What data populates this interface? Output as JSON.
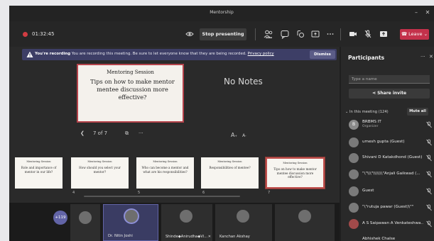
{
  "window": {
    "title": "Mentorship"
  },
  "toolbar": {
    "timer": "01:32:45",
    "stop_presenting": "Stop presenting",
    "leave": "Leave"
  },
  "banner": {
    "lead": "You're recording",
    "message": "You are recording this meeting. Be sure to let everyone know that they are being recorded.",
    "link": "Privacy policy",
    "dismiss": "Dismiss"
  },
  "slide": {
    "heading": "Mentoring Session",
    "body": "Tips on how to make mentor mentee discussion more effective?"
  },
  "notes": {
    "empty": "No Notes"
  },
  "slide_nav": {
    "position": "7 of 7",
    "more": "···"
  },
  "font_controls": {
    "larger": "A",
    "smaller": "A"
  },
  "thumbnails": [
    {
      "heading": "Mentoring Session",
      "body": "Role and importance of mentor in our life?",
      "num": ""
    },
    {
      "heading": "Mentoring Session",
      "body": "How should you select your mentor?",
      "num": "4"
    },
    {
      "heading": "Mentoring Session",
      "body": "Who can become a mentor and what are his responsibilities?",
      "num": "5"
    },
    {
      "heading": "Mentoring Session",
      "body": "Responsibilities of mentee?",
      "num": "6"
    },
    {
      "heading": "Mentoring Session",
      "body": "Tips on how to make mentor mentee discussion more effective?",
      "num": "7"
    }
  ],
  "video_strip": {
    "more_count": "+119",
    "tiles": [
      {
        "name": ""
      },
      {
        "name": "Dr. Nitin Joshi"
      },
      {
        "name": "Shinde◆Anirudha◆Vi..."
      },
      {
        "name": "Kanchan Akshay"
      },
      {
        "name": ""
      }
    ]
  },
  "participants": {
    "title": "Participants",
    "search_placeholder": "Type a name",
    "share_invite": "Share invite",
    "section": "In this meeting (124)",
    "mute_all": "Mute all",
    "list": [
      {
        "name": "BRBMS IT",
        "sub": "Organizer",
        "initials": "B"
      },
      {
        "name": "umesh gupta (Guest)",
        "sub": "",
        "initials": ""
      },
      {
        "name": "Shivani D Katakdhond (Guest)",
        "sub": "",
        "initials": ""
      },
      {
        "name": "\"\\\"\\\\\\\"\\\\\\\\\\\\\\\"Anjali Gaikwad (...",
        "sub": "",
        "initials": ""
      },
      {
        "name": "Guest",
        "sub": "",
        "initials": ""
      },
      {
        "name": "\"\\\"rutuja pawar (Guest)\\\"\"",
        "sub": "",
        "initials": ""
      },
      {
        "name": "A S Saipawan A Venkateshwa...",
        "sub": "",
        "initials": ""
      },
      {
        "name": "Abhishek Chalse",
        "sub": "",
        "initials": ""
      }
    ]
  },
  "colors": {
    "accent": "#6264a7",
    "leave": "#c4314b",
    "banner": "#3d3e66",
    "recording": "#d13c42",
    "slide_border": "#b5434b"
  }
}
